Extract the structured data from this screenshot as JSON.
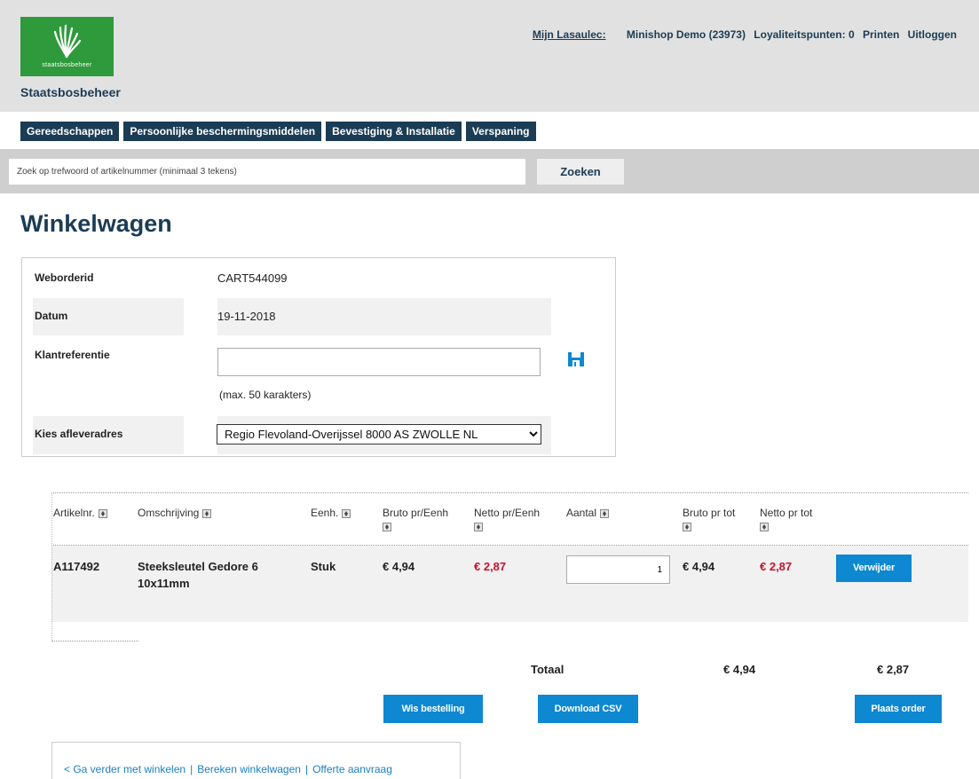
{
  "header": {
    "logo_text": "staatsbosbeheer",
    "org_name": "Staatsbosbeheer",
    "nav": {
      "mijn": "Mijn Lasaulec:",
      "account": "Minishop Demo (23973)",
      "points": "Loyaliteitspunten: 0",
      "print": "Printen",
      "logout": "Uitloggen"
    }
  },
  "menu": [
    "Gereedschappen",
    "Persoonlijke beschermingsmiddelen",
    "Bevestiging & Installatie",
    "Verspaning"
  ],
  "search": {
    "placeholder": "Zoek op trefwoord of artikelnummer (minimaal 3 tekens)",
    "button": "Zoeken"
  },
  "page_title": "Winkelwagen",
  "order_info": {
    "weborderid_label": "Weborderid",
    "weborderid": "CART544099",
    "datum_label": "Datum",
    "datum": "19-11-2018",
    "klantref_label": "Klantreferentie",
    "klantref_value": "",
    "klantref_hint": "(max. 50 karakters)",
    "address_label": "Kies afleveradres",
    "address_selected": "Regio Flevoland-Overijssel 8000 AS ZWOLLE NL"
  },
  "cart": {
    "columns": {
      "artikelnr": "Artikelnr.",
      "omschrijving": "Omschrijving",
      "eenh": "Eenh.",
      "bruto_eenh": "Bruto pr/Eenh",
      "netto_eenh": "Netto pr/Eenh",
      "aantal": "Aantal",
      "bruto_tot": "Bruto pr tot",
      "netto_tot": "Netto pr tot"
    },
    "rows": [
      {
        "artikelnr": "A117492",
        "omschrijving_line1": "Steeksleutel Gedore 6",
        "omschrijving_line2": "10x11mm",
        "eenh": "Stuk",
        "bruto_eenh": "€ 4,94",
        "netto_eenh": "€ 2,87",
        "aantal": "1",
        "bruto_tot": "€ 4,94",
        "netto_tot": "€ 2,87",
        "remove": "Verwijder"
      }
    ],
    "totals": {
      "label": "Totaal",
      "bruto": "€ 4,94",
      "netto": "€ 2,87"
    }
  },
  "actions": {
    "clear": "Wis bestelling",
    "csv": "Download CSV",
    "place": "Plaats order"
  },
  "footer_links": {
    "continue": "< Ga verder met winkelen",
    "calculate": "Bereken winkelwagen",
    "quote": "Offerte aanvraag",
    "separator": "|"
  },
  "colors": {
    "brand_dark": "#1b3c55",
    "brand_green": "#2f9a3c",
    "accent_blue": "#0d88d1",
    "price_red": "#c8102e"
  }
}
